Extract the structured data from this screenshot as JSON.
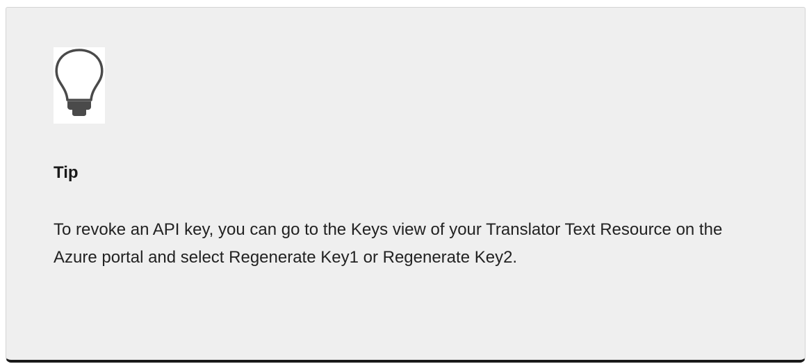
{
  "tip": {
    "icon": "lightbulb-icon",
    "title": "Tip",
    "body": "To revoke an API key, you can go to the Keys view of your Translator Text Resource on the Azure portal and select Regenerate Key1 or Regenerate Key2."
  },
  "colors": {
    "background": "#efefef",
    "bottom_border": "#1a1a1a",
    "icon": "#4a4a4a",
    "text": "#222222"
  }
}
